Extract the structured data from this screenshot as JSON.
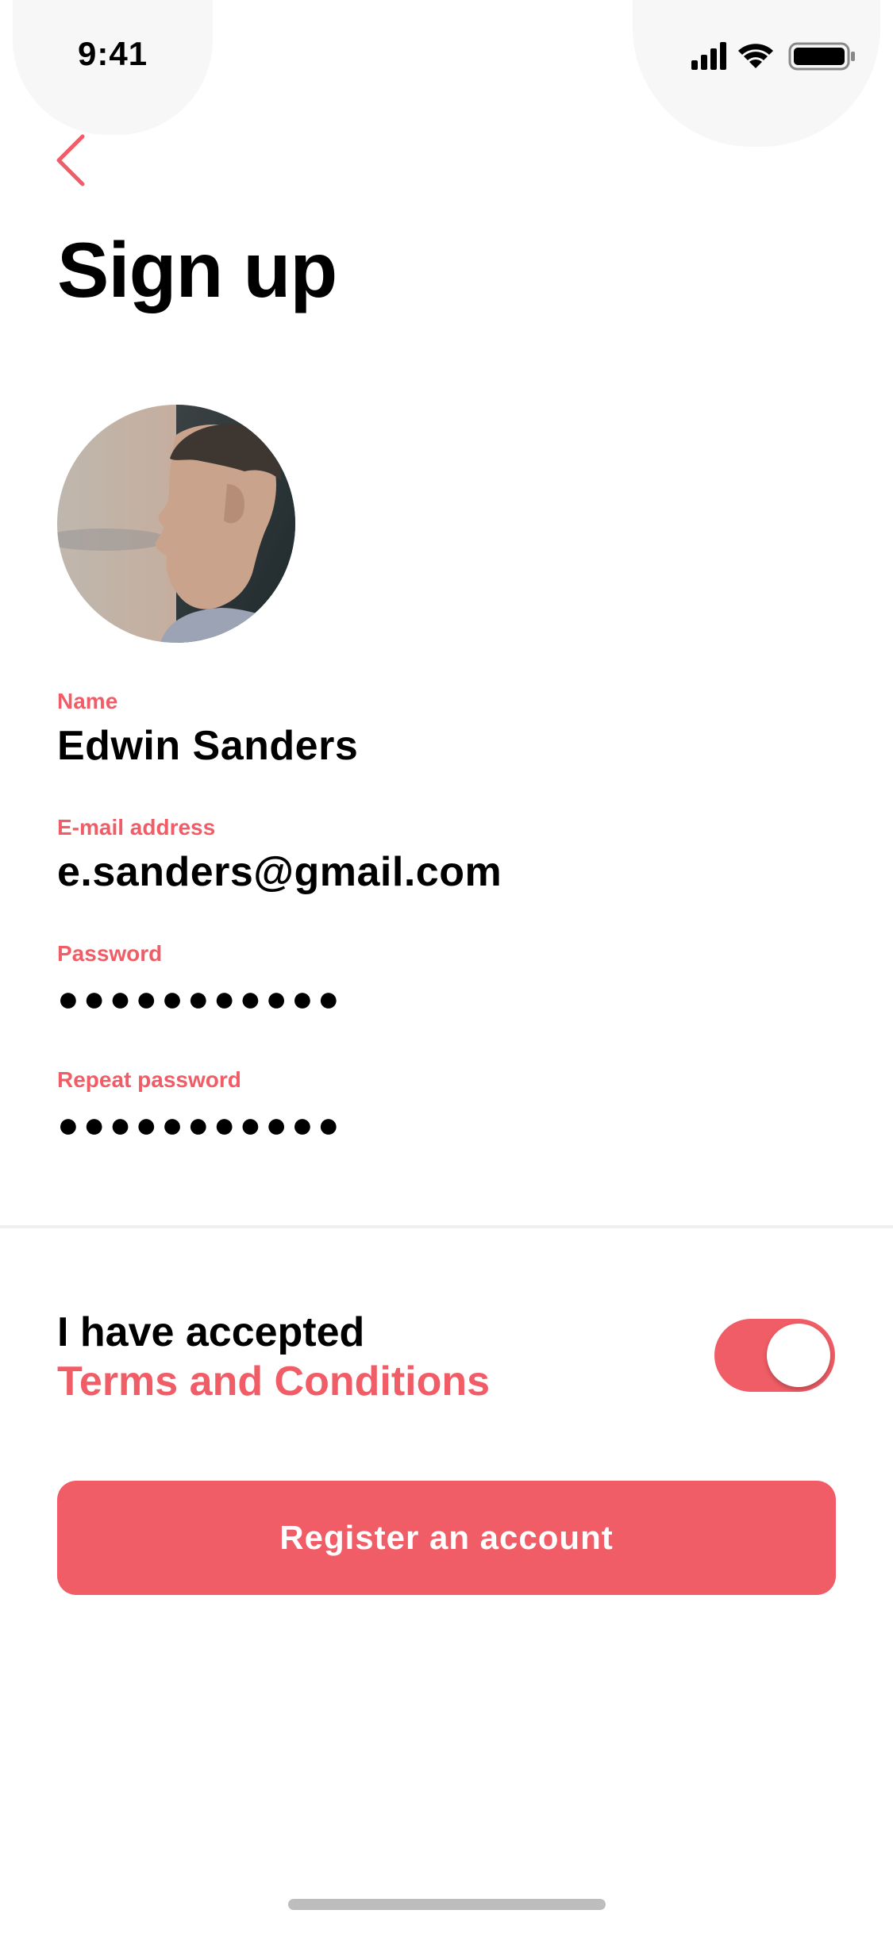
{
  "status_bar": {
    "time": "9:41"
  },
  "page": {
    "title": "Sign up"
  },
  "form": {
    "fields": [
      {
        "label": "Name",
        "value": "Edwin Sanders"
      },
      {
        "label": "E-mail address",
        "value": "e.sanders@gmail.com"
      },
      {
        "label": "Password",
        "value": "●●●●●●●●●●●"
      },
      {
        "label": "Repeat password",
        "value": "●●●●●●●●●●●"
      }
    ]
  },
  "terms": {
    "line1": "I have accepted",
    "link": "Terms and Conditions",
    "accepted": true
  },
  "register_button": {
    "label": "Register an account"
  },
  "colors": {
    "accent": "#f05d66",
    "text": "#000000",
    "background": "#ffffff",
    "divider": "#efefef"
  },
  "icons": [
    "back-chevron-icon",
    "signal-icon",
    "wifi-icon",
    "battery-icon"
  ]
}
